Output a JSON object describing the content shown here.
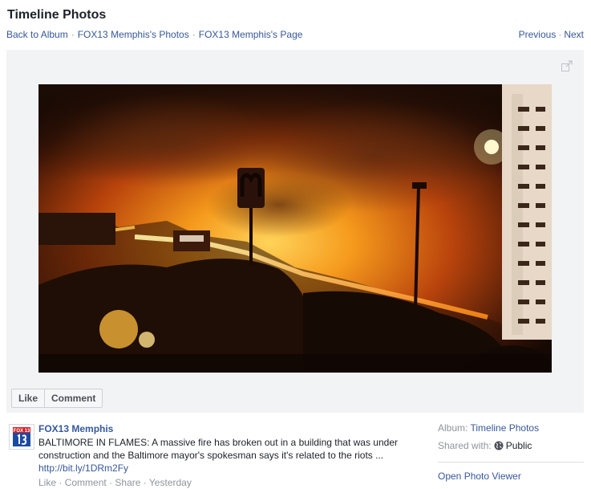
{
  "header": {
    "title": "Timeline Photos",
    "breadcrumbs": [
      {
        "label": "Back to Album"
      },
      {
        "label": "FOX13 Memphis's Photos"
      },
      {
        "label": "FOX13 Memphis's Page"
      }
    ],
    "separator": "·",
    "previous_label": "Previous",
    "next_label": "Next"
  },
  "photo": {
    "alt": "Fire burning behind a McDonald's sign at night in Baltimore"
  },
  "actions": {
    "like_label": "Like",
    "comment_label": "Comment"
  },
  "post": {
    "avatar_text": "FOX 13",
    "author": "FOX13 Memphis",
    "message": "BALTIMORE IN FLAMES: A massive fire has broken out in a building that was under construction and the Baltimore mayor's spokesman says it's related to the riots ...",
    "url": "http://bit.ly/1DRm2Fy",
    "meta_like": "Like",
    "meta_comment": "Comment",
    "meta_share": "Share",
    "meta_time": "Yesterday"
  },
  "sidebar": {
    "album_label": "Album:",
    "album_value": "Timeline Photos",
    "shared_label": "Shared with:",
    "shared_value": "Public",
    "open_viewer_label": "Open Photo Viewer"
  },
  "colors": {
    "link": "#365899",
    "muted": "#90949c",
    "stage_bg": "#f2f3f5",
    "fox_blue": "#1b4aa3",
    "fox_red": "#d62027"
  }
}
